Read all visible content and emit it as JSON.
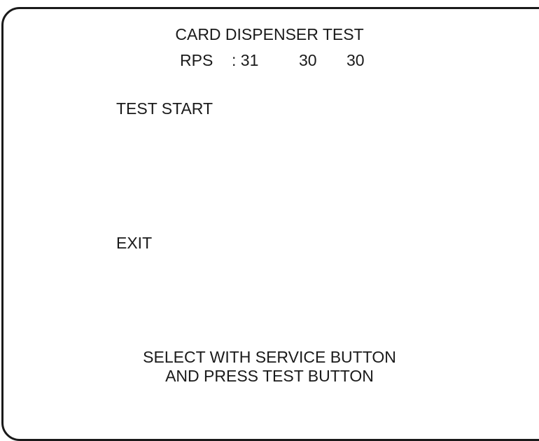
{
  "screen": {
    "title": "CARD DISPENSER TEST",
    "rps_label": "RPS",
    "rps_sep": ": 31",
    "rps_v2": "30",
    "rps_v3": "30"
  },
  "menu": {
    "items": [
      {
        "label": "TEST START"
      },
      {
        "label": "EXIT"
      }
    ]
  },
  "instructions": {
    "line1": "SELECT WITH SERVICE BUTTON",
    "line2": "AND PRESS TEST BUTTON"
  }
}
